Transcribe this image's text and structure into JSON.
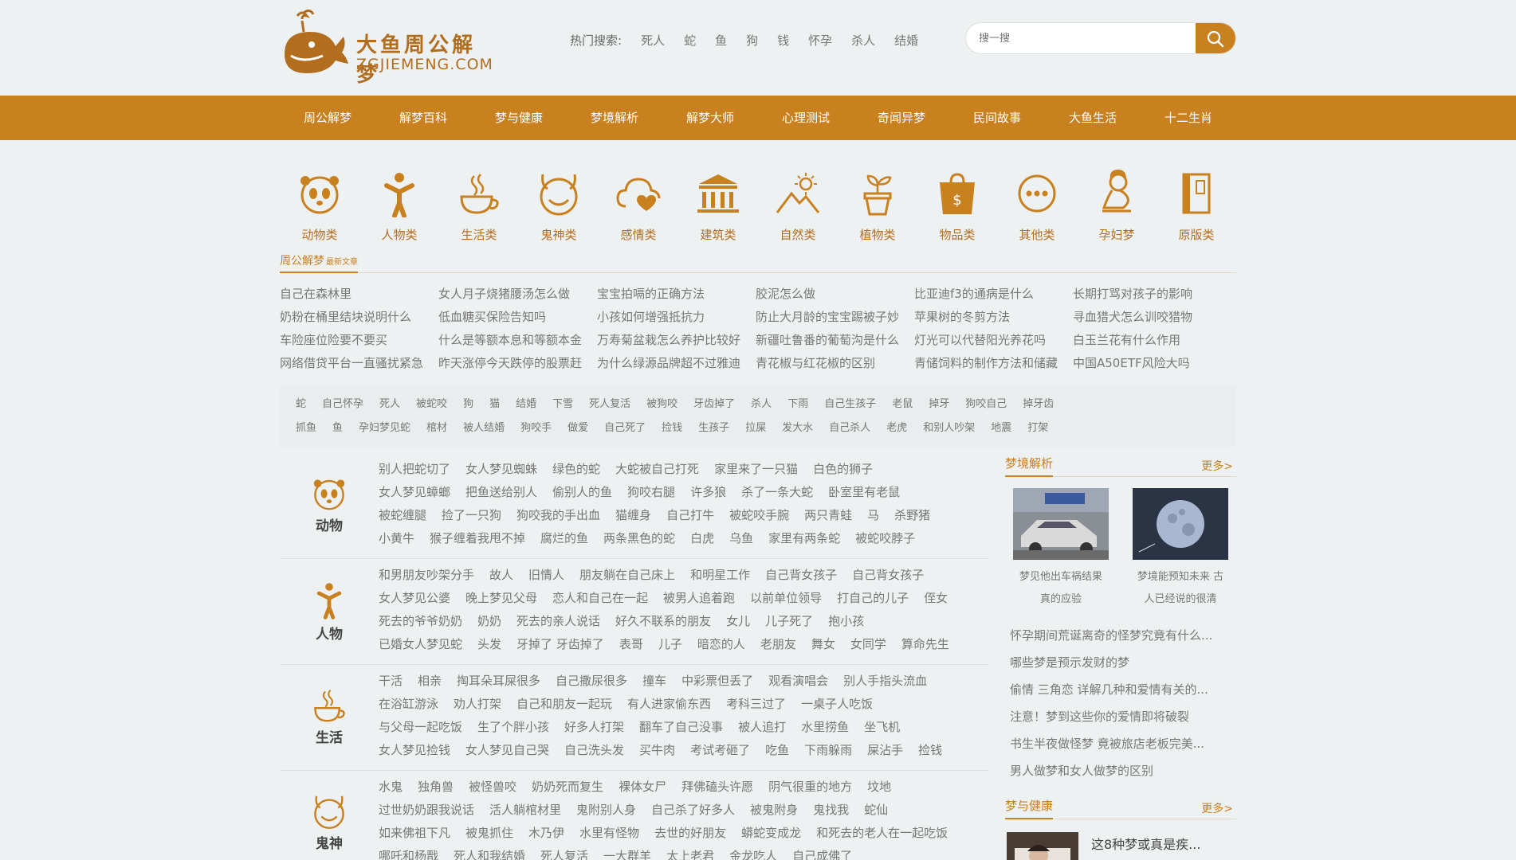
{
  "logo": {
    "title": "大鱼周公解梦",
    "domain": "ZGJIEMENG.COM"
  },
  "hot_search": {
    "label": "热门搜索:",
    "keywords": [
      "死人",
      "蛇",
      "鱼",
      "狗",
      "钱",
      "怀孕",
      "杀人",
      "结婚"
    ]
  },
  "search": {
    "placeholder": "搜一搜"
  },
  "nav": [
    "周公解梦",
    "解梦百科",
    "梦与健康",
    "梦境解析",
    "解梦大师",
    "心理测试",
    "奇闻异梦",
    "民间故事",
    "大鱼生活",
    "十二生肖"
  ],
  "categories": [
    "动物类",
    "人物类",
    "生活类",
    "鬼神类",
    "感情类",
    "建筑类",
    "自然类",
    "植物类",
    "物品类",
    "其他类",
    "孕妇梦",
    "原版类"
  ],
  "latest": {
    "title": "周公解梦",
    "subtitle": "最新文章",
    "items": [
      "自己在森林里",
      "女人月子烧猪腰汤怎么做",
      "宝宝拍嗝的正确方法",
      "胶泥怎么做",
      "比亚迪f3的通病是什么",
      "长期打骂对孩子的影响",
      "奶粉在桶里结块说明什么",
      "低血糖买保险告知吗",
      "小孩如何增强抵抗力",
      "防止大月龄的宝宝踢被子妙",
      "苹果树的冬剪方法",
      "寻血猎犬怎么训咬猎物",
      "车险座位险要不要买",
      "什么是等额本息和等额本金",
      "万寿菊盆栽怎么养护比较好",
      "新疆吐鲁番的葡萄沟是什么",
      "灯光可以代替阳光养花吗",
      "白玉兰花有什么作用",
      "网络借贷平台一直骚扰紧急",
      "昨天涨停今天跌停的股票赶",
      "为什么绿源品牌超不过雅迪",
      "青花椒与红花椒的区别",
      "青储饲料的制作方法和储藏",
      "中国A50ETF风险大吗"
    ]
  },
  "tags": [
    [
      "蛇",
      "自己怀孕",
      "死人",
      "被蛇咬",
      "狗",
      "猫",
      "结婚",
      "下雪",
      "死人复活",
      "被狗咬",
      "牙齿掉了",
      "杀人",
      "下雨",
      "自己生孩子",
      "老鼠",
      "掉牙",
      "狗咬自己",
      "掉牙齿"
    ],
    [
      "抓鱼",
      "鱼",
      "孕妇梦见蛇",
      "棺材",
      "被人结婚",
      "狗咬手",
      "做爱",
      "自己死了",
      "捡钱",
      "生孩子",
      "拉屎",
      "发大水",
      "自己杀人",
      "老虎",
      "和别人吵架",
      "地震",
      "打架"
    ]
  ],
  "blocks": [
    {
      "name": "动物",
      "rows": [
        [
          "别人把蛇切了",
          "女人梦见蜘蛛",
          "绿色的蛇",
          "大蛇被自己打死",
          "家里来了一只猫",
          "白色的狮子"
        ],
        [
          "女人梦见蟑螂",
          "把鱼送给别人",
          "偷别人的鱼",
          "狗咬右腿",
          "许多狼",
          "杀了一条大蛇",
          "卧室里有老鼠"
        ],
        [
          "被蛇缠腿",
          "捡了一只狗",
          "狗咬我的手出血",
          "猫缠身",
          "自己打牛",
          "被蛇咬手腕",
          "两只青蛙",
          "马",
          "杀野猪"
        ],
        [
          "小黄牛",
          "猴子缠着我甩不掉",
          "腐烂的鱼",
          "两条黑色的蛇",
          "白虎",
          "乌鱼",
          "家里有两条蛇",
          "被蛇咬脖子"
        ]
      ]
    },
    {
      "name": "人物",
      "rows": [
        [
          "和男朋友吵架分手",
          "故人",
          "旧情人",
          "朋友躺在自己床上",
          "和明星工作",
          "自己背女孩子",
          "自己背女孩子"
        ],
        [
          "女人梦见公婆",
          "晚上梦见父母",
          "恋人和自己在一起",
          "被男人追着跑",
          "以前单位领导",
          "打自己的儿子",
          "侄女"
        ],
        [
          "死去的爷爷奶奶",
          "奶奶",
          "死去的亲人说话",
          "好久不联系的朋友",
          "女儿",
          "儿子死了",
          "抱小孩"
        ],
        [
          "已婚女人梦见蛇",
          "头发",
          "牙掉了 牙齿掉了",
          "表哥",
          "儿子",
          "暗恋的人",
          "老朋友",
          "舞女",
          "女同学",
          "算命先生"
        ]
      ]
    },
    {
      "name": "生活",
      "rows": [
        [
          "干活",
          "相亲",
          "掏耳朵耳屎很多",
          "自己撒尿很多",
          "撞车",
          "中彩票但丢了",
          "观看演唱会",
          "别人手指头流血"
        ],
        [
          "在浴缸游泳",
          "劝人打架",
          "自己和朋友一起玩",
          "有人进家偷东西",
          "考科三过了",
          "一桌子人吃饭"
        ],
        [
          "与父母一起吃饭",
          "生了个胖小孩",
          "好多人打架",
          "翻车了自己没事",
          "被人追打",
          "水里捞鱼",
          "坐飞机"
        ],
        [
          "女人梦见捡钱",
          "女人梦见自己哭",
          "自己洗头发",
          "买牛肉",
          "考试考砸了",
          "吃鱼",
          "下雨躲雨",
          "屎沾手",
          "捡钱"
        ]
      ]
    },
    {
      "name": "鬼神",
      "rows": [
        [
          "水鬼",
          "独角兽",
          "被怪兽咬",
          "奶奶死而复生",
          "裸体女尸",
          "拜佛磕头许愿",
          "阴气很重的地方",
          "坟地"
        ],
        [
          "过世奶奶跟我说话",
          "活人躺棺材里",
          "鬼附别人身",
          "自己杀了好多人",
          "被鬼附身",
          "鬼找我",
          "蛇仙"
        ],
        [
          "如来佛祖下凡",
          "被鬼抓住",
          "木乃伊",
          "水里有怪物",
          "去世的好朋友",
          "蟒蛇变成龙",
          "和死去的老人在一起吃饭"
        ],
        [
          "哪吒和杨戬",
          "死人和我结婚",
          "死人复活",
          "一大群羊",
          "太上老君",
          "金龙吃人",
          "自己成佛了"
        ]
      ]
    }
  ],
  "sidebar": {
    "analysis": {
      "title": "梦境解析",
      "more": "更多>",
      "thumbs": [
        {
          "caption1": "梦见他出车祸结果",
          "caption2": "真的应验"
        },
        {
          "caption1": "梦境能预知未来 古",
          "caption2": "人已经说的很清"
        }
      ],
      "list": [
        "怀孕期间荒诞离奇的怪梦究竟有什么...",
        "哪些梦是预示发财的梦",
        "偷情 三角恋 详解几种和爱情有关的...",
        "注意！梦到这些你的爱情即将破裂",
        "书生半夜做怪梦 竟被旅店老板完美...",
        "男人做梦和女人做梦的区别"
      ]
    },
    "health": {
      "title": "梦与健康",
      "more": "更多>",
      "first": "这8种梦或真是疾..."
    }
  },
  "colors": {
    "accent": "#c9801f",
    "brand_text": "#b36d1f",
    "background": "#eef1f1"
  }
}
